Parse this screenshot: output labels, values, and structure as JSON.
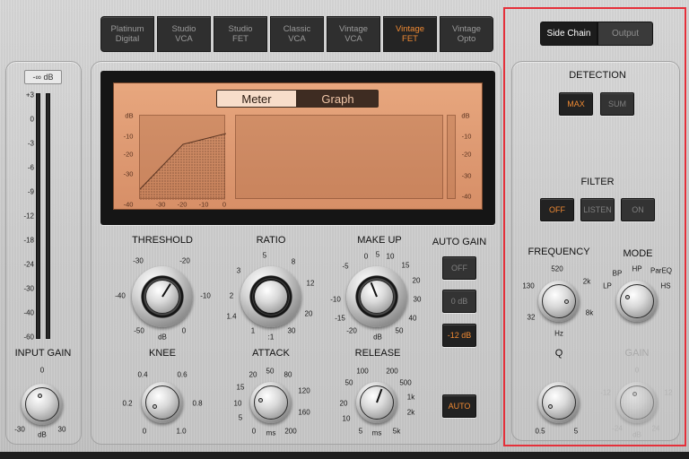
{
  "models": [
    {
      "line1": "Platinum",
      "line2": "Digital",
      "active": false
    },
    {
      "line1": "Studio",
      "line2": "VCA",
      "active": false
    },
    {
      "line1": "Studio",
      "line2": "FET",
      "active": false
    },
    {
      "line1": "Classic",
      "line2": "VCA",
      "active": false
    },
    {
      "line1": "Vintage",
      "line2": "VCA",
      "active": false
    },
    {
      "line1": "Vintage",
      "line2": "FET",
      "active": true
    },
    {
      "line1": "Vintage",
      "line2": "Opto",
      "active": false
    }
  ],
  "input": {
    "db_readout": "-∞ dB",
    "scale": [
      "+3",
      "0",
      "-3",
      "-6",
      "-9",
      "-12",
      "-18",
      "-24",
      "-30",
      "-40",
      "-60"
    ],
    "gain_label": "INPUT GAIN",
    "gain_ticks": {
      "top": "0",
      "left": "-30",
      "right": "30",
      "unit": "dB"
    }
  },
  "display": {
    "meter_label": "Meter",
    "graph_label": "Graph",
    "active_view": "Graph",
    "db_label": "dB",
    "left_scale": [
      "-10",
      "-20",
      "-30"
    ],
    "bottom_scale": [
      "-40",
      "-30",
      "-20",
      "-10",
      "0"
    ],
    "right_scale": [
      "-10",
      "-20",
      "-30",
      "-40"
    ],
    "right_db_label": "dB"
  },
  "controls": {
    "threshold": {
      "label": "THRESHOLD",
      "ticks": [
        "-30",
        "-20",
        "-40",
        "-10",
        "-50",
        "0"
      ],
      "unit": "dB"
    },
    "ratio": {
      "label": "RATIO",
      "ticks": [
        "5",
        "3",
        "8",
        "2",
        "12",
        "1.4",
        "20",
        "1",
        ":1",
        "30"
      ]
    },
    "makeup": {
      "label": "MAKE UP",
      "ticks": [
        "0",
        "5",
        "10",
        "-5",
        "15",
        "-10",
        "20",
        "-15",
        "30",
        "-20",
        "40",
        "50"
      ],
      "unit": "dB"
    },
    "auto_gain": {
      "label": "AUTO GAIN",
      "options": [
        "OFF",
        "0 dB",
        "-12 dB"
      ],
      "selected": "-12 dB"
    },
    "knee": {
      "label": "KNEE",
      "ticks": [
        "0.4",
        "0.6",
        "0.2",
        "0.8",
        "0",
        "1.0"
      ]
    },
    "attack": {
      "label": "ATTACK",
      "ticks": [
        "20",
        "50",
        "15",
        "80",
        "10",
        "120",
        "5",
        "160",
        "0",
        "200"
      ],
      "unit": "ms"
    },
    "release": {
      "label": "RELEASE",
      "ticks": [
        "100",
        "200",
        "50",
        "500",
        "20",
        "1k",
        "10",
        "2k",
        "5",
        "5k"
      ],
      "unit": "ms"
    },
    "auto_label": "AUTO"
  },
  "sidechain": {
    "tabs": [
      "Side Chain",
      "Output"
    ],
    "active_tab": "Side Chain",
    "detection": {
      "label": "DETECTION",
      "options": [
        "MAX",
        "SUM"
      ],
      "selected": "MAX"
    },
    "filter": {
      "label": "FILTER",
      "options": [
        "OFF",
        "LISTEN",
        "ON"
      ],
      "selected": "OFF"
    },
    "frequency": {
      "label": "FREQUENCY",
      "ticks": [
        "520",
        "130",
        "2k",
        "32",
        "8k"
      ],
      "unit": "Hz"
    },
    "mode": {
      "label": "MODE",
      "ticks": [
        "HP",
        "BP",
        "ParEQ",
        "LP",
        "HS"
      ]
    },
    "q": {
      "label": "Q",
      "ticks": [
        "0.5",
        "5"
      ]
    },
    "gain": {
      "label": "GAIN",
      "ticks": [
        "0",
        "-12",
        "12",
        "-24",
        "24"
      ],
      "unit": "dB"
    }
  },
  "colors": {
    "accent": "#f08a33",
    "highlight": "#e5303a",
    "display": "#dd9972"
  }
}
